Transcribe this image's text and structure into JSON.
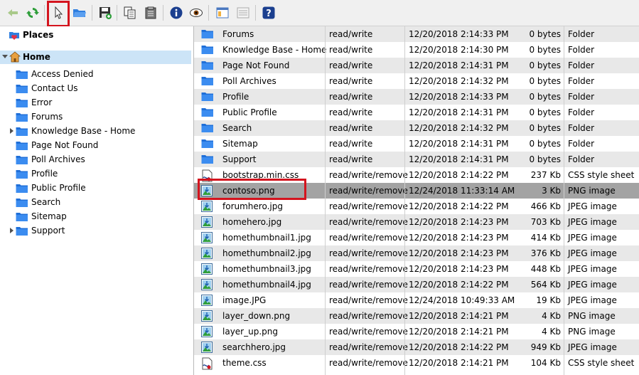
{
  "toolbar": {
    "buttons": [
      {
        "name": "back-button",
        "icon": "back-arrow-icon"
      },
      {
        "name": "refresh-button",
        "icon": "refresh-icon"
      },
      {
        "name": "select-pointer-button",
        "icon": "pointer-icon"
      },
      {
        "name": "open-folder-button",
        "icon": "folder-open-icon"
      },
      {
        "name": "save-button",
        "icon": "save-icon"
      },
      {
        "name": "copy-button",
        "icon": "copy-icon"
      },
      {
        "name": "paste-button",
        "icon": "clipboard-icon"
      },
      {
        "name": "info-button",
        "icon": "info-icon"
      },
      {
        "name": "preview-button",
        "icon": "eye-icon"
      },
      {
        "name": "layout-view-button",
        "icon": "window-layout-icon"
      },
      {
        "name": "list-view-button",
        "icon": "list-icon"
      },
      {
        "name": "help-button",
        "icon": "help-icon"
      }
    ]
  },
  "tree": {
    "places_label": "Places",
    "home_label": "Home",
    "items": [
      {
        "label": "Access Denied",
        "expandable": false
      },
      {
        "label": "Contact Us",
        "expandable": false
      },
      {
        "label": "Error",
        "expandable": false
      },
      {
        "label": "Forums",
        "expandable": false
      },
      {
        "label": "Knowledge Base - Home",
        "expandable": true
      },
      {
        "label": "Page Not Found",
        "expandable": false
      },
      {
        "label": "Poll Archives",
        "expandable": false
      },
      {
        "label": "Profile",
        "expandable": false
      },
      {
        "label": "Public Profile",
        "expandable": false
      },
      {
        "label": "Search",
        "expandable": false
      },
      {
        "label": "Sitemap",
        "expandable": false
      },
      {
        "label": "Support",
        "expandable": true
      }
    ]
  },
  "files": [
    {
      "name": "Forums",
      "perm": "read/write",
      "date": "12/20/2018 2:14:33 PM",
      "size": "0 bytes",
      "type": "Folder",
      "icon": "folder-icon"
    },
    {
      "name": "Knowledge Base - Home",
      "perm": "read/write",
      "date": "12/20/2018 2:14:30 PM",
      "size": "0 bytes",
      "type": "Folder",
      "icon": "folder-icon"
    },
    {
      "name": "Page Not Found",
      "perm": "read/write",
      "date": "12/20/2018 2:14:31 PM",
      "size": "0 bytes",
      "type": "Folder",
      "icon": "folder-icon"
    },
    {
      "name": "Poll Archives",
      "perm": "read/write",
      "date": "12/20/2018 2:14:32 PM",
      "size": "0 bytes",
      "type": "Folder",
      "icon": "folder-icon"
    },
    {
      "name": "Profile",
      "perm": "read/write",
      "date": "12/20/2018 2:14:33 PM",
      "size": "0 bytes",
      "type": "Folder",
      "icon": "folder-icon"
    },
    {
      "name": "Public Profile",
      "perm": "read/write",
      "date": "12/20/2018 2:14:31 PM",
      "size": "0 bytes",
      "type": "Folder",
      "icon": "folder-icon"
    },
    {
      "name": "Search",
      "perm": "read/write",
      "date": "12/20/2018 2:14:32 PM",
      "size": "0 bytes",
      "type": "Folder",
      "icon": "folder-icon"
    },
    {
      "name": "Sitemap",
      "perm": "read/write",
      "date": "12/20/2018 2:14:31 PM",
      "size": "0 bytes",
      "type": "Folder",
      "icon": "folder-icon"
    },
    {
      "name": "Support",
      "perm": "read/write",
      "date": "12/20/2018 2:14:31 PM",
      "size": "0 bytes",
      "type": "Folder",
      "icon": "folder-icon"
    },
    {
      "name": "bootstrap.min.css",
      "perm": "read/write/remove",
      "date": "12/20/2018 2:14:22 PM",
      "size": "237 Kb",
      "type": "CSS style sheet",
      "icon": "css-file-icon"
    },
    {
      "name": "contoso.png",
      "perm": "read/write/remove",
      "date": "12/24/2018 11:33:14 AM",
      "size": "3 Kb",
      "type": "PNG image",
      "icon": "image-file-icon"
    },
    {
      "name": "forumhero.jpg",
      "perm": "read/write/remove",
      "date": "12/20/2018 2:14:22 PM",
      "size": "466 Kb",
      "type": "JPEG image",
      "icon": "image-file-icon"
    },
    {
      "name": "homehero.jpg",
      "perm": "read/write/remove",
      "date": "12/20/2018 2:14:23 PM",
      "size": "703 Kb",
      "type": "JPEG image",
      "icon": "image-file-icon"
    },
    {
      "name": "homethumbnail1.jpg",
      "perm": "read/write/remove",
      "date": "12/20/2018 2:14:23 PM",
      "size": "414 Kb",
      "type": "JPEG image",
      "icon": "image-file-icon"
    },
    {
      "name": "homethumbnail2.jpg",
      "perm": "read/write/remove",
      "date": "12/20/2018 2:14:23 PM",
      "size": "376 Kb",
      "type": "JPEG image",
      "icon": "image-file-icon"
    },
    {
      "name": "homethumbnail3.jpg",
      "perm": "read/write/remove",
      "date": "12/20/2018 2:14:23 PM",
      "size": "448 Kb",
      "type": "JPEG image",
      "icon": "image-file-icon"
    },
    {
      "name": "homethumbnail4.jpg",
      "perm": "read/write/remove",
      "date": "12/20/2018 2:14:22 PM",
      "size": "564 Kb",
      "type": "JPEG image",
      "icon": "image-file-icon"
    },
    {
      "name": "image.JPG",
      "perm": "read/write/remove",
      "date": "12/24/2018 10:49:33 AM",
      "size": "19 Kb",
      "type": "JPEG image",
      "icon": "image-file-icon"
    },
    {
      "name": "layer_down.png",
      "perm": "read/write/remove",
      "date": "12/20/2018 2:14:21 PM",
      "size": "4 Kb",
      "type": "PNG image",
      "icon": "image-file-icon"
    },
    {
      "name": "layer_up.png",
      "perm": "read/write/remove",
      "date": "12/20/2018 2:14:21 PM",
      "size": "4 Kb",
      "type": "PNG image",
      "icon": "image-file-icon"
    },
    {
      "name": "searchhero.jpg",
      "perm": "read/write/remove",
      "date": "12/20/2018 2:14:22 PM",
      "size": "949 Kb",
      "type": "JPEG image",
      "icon": "image-file-icon"
    },
    {
      "name": "theme.css",
      "perm": "read/write/remove",
      "date": "12/20/2018 2:14:21 PM",
      "size": "104 Kb",
      "type": "CSS style sheet",
      "icon": "css-file-icon"
    }
  ],
  "selected_file": "contoso.png",
  "colors": {
    "selection": "#a3a3a3",
    "alt_row": "#e8e8e8",
    "tree_highlight": "#cce4f7",
    "folder_blue": "#2f7fe0",
    "highlight_box": "#d4141e"
  }
}
